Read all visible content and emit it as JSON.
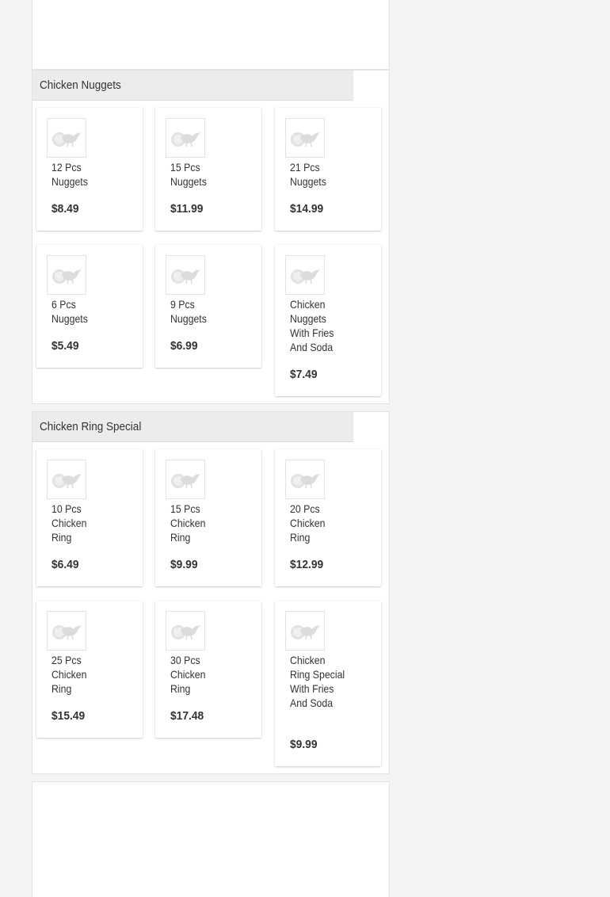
{
  "sections": [
    {
      "title": "Chicken Nuggets",
      "items": [
        {
          "name": "12 Pcs Nuggets",
          "price": "$8.49"
        },
        {
          "name": "15 Pcs Nuggets",
          "price": "$11.99"
        },
        {
          "name": "21 Pcs Nuggets",
          "price": "$14.99"
        },
        {
          "name": "6 Pcs Nuggets",
          "price": "$5.49"
        },
        {
          "name": "9 Pcs Nuggets",
          "price": "$6.99"
        },
        {
          "name": "Chicken Nuggets With Fries And Soda",
          "price": "$7.49"
        }
      ]
    },
    {
      "title": "Chicken Ring Special",
      "items": [
        {
          "name": "10 Pcs Chicken Ring",
          "price": "$6.49"
        },
        {
          "name": "15 Pcs Chicken Ring",
          "price": "$9.99"
        },
        {
          "name": "20 Pcs Chicken Ring",
          "price": "$12.99"
        },
        {
          "name": "25 Pcs Chicken Ring",
          "price": "$15.49"
        },
        {
          "name": "30 Pcs Chicken Ring",
          "price": "$17.48"
        },
        {
          "name": "Chicken Ring Special With Fries And Soda",
          "price": "$9.99"
        }
      ]
    }
  ],
  "icons": {
    "item_thumbnail": "chicken-placeholder-icon"
  }
}
